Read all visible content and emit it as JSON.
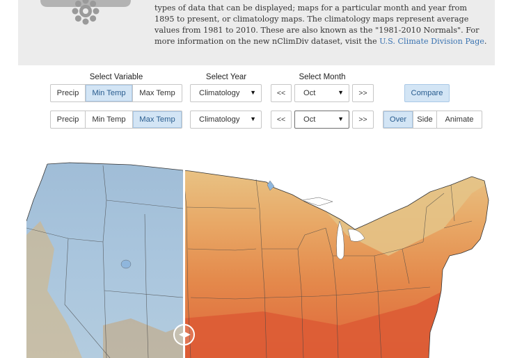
{
  "intro": {
    "text_before_link": "types of data that can be displayed; maps for a particular month and year from 1895 to present, or climatology maps. The climatology maps represent average values from 1981 to 2010. These are also known as the \"1981-2010 Normals\". For more information on the new nClimDiv dataset, visit the ",
    "link_text": "U.S. Climate Division Page",
    "text_after_link": "."
  },
  "controls": {
    "variable_label": "Select Variable",
    "year_label": "Select Year",
    "month_label": "Select Month",
    "row1": {
      "variables": [
        "Precip",
        "Min Temp",
        "Max Temp"
      ],
      "active_variable": "Min Temp",
      "year": "Climatology",
      "prev": "<<",
      "month": "Oct",
      "next": ">>",
      "compare": "Compare"
    },
    "row2": {
      "variables": [
        "Precip",
        "Min Temp",
        "Max Temp"
      ],
      "active_variable": "Max Temp",
      "year": "Climatology",
      "prev": "<<",
      "month": "Oct",
      "next": ">>",
      "modes": [
        "Over",
        "Side",
        "Animate"
      ],
      "active_mode": "Over"
    }
  },
  "colors": {
    "accent": "#3a73b1",
    "active_bg": "#d3e5f5",
    "min_temp_cool": "#a7c4df",
    "max_temp_warm": "#e0742f"
  },
  "icons": {
    "dropdown": "caret-down-icon",
    "weather": "snowflake-cloud-icon",
    "slider": "slider-handle-icon"
  },
  "map": {
    "type": "us-climate-division-map",
    "swipe_position": 0.34
  }
}
